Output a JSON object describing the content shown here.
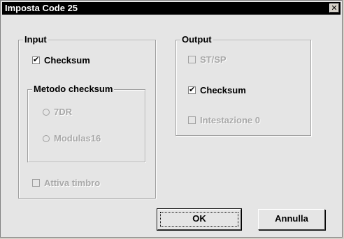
{
  "window": {
    "title": "Imposta Code 25",
    "close_glyph": "✕"
  },
  "input_group": {
    "legend": "Input",
    "checksum": {
      "label": "Checksum",
      "checked": true,
      "enabled": true
    },
    "method_group": {
      "legend": "Metodo checksum",
      "options": [
        {
          "label": "7DR",
          "selected": false,
          "enabled": false
        },
        {
          "label": "Modulas16",
          "selected": false,
          "enabled": false
        }
      ]
    },
    "stamp": {
      "label": "Attiva timbro",
      "checked": false,
      "enabled": false
    }
  },
  "output_group": {
    "legend": "Output",
    "stsp": {
      "label": "ST/SP",
      "checked": false,
      "enabled": false
    },
    "checksum": {
      "label": "Checksum",
      "checked": true,
      "enabled": true
    },
    "header_zero": {
      "label": "Intestazione 0",
      "checked": false,
      "enabled": false
    }
  },
  "buttons": {
    "ok": "OK",
    "cancel": "Annulla"
  },
  "colors": {
    "titlebar": "#000000",
    "face": "#e5e5e5",
    "disabled_text": "#a8a8a8"
  },
  "icons": {
    "check": "checkmark-icon",
    "close": "close-icon"
  }
}
